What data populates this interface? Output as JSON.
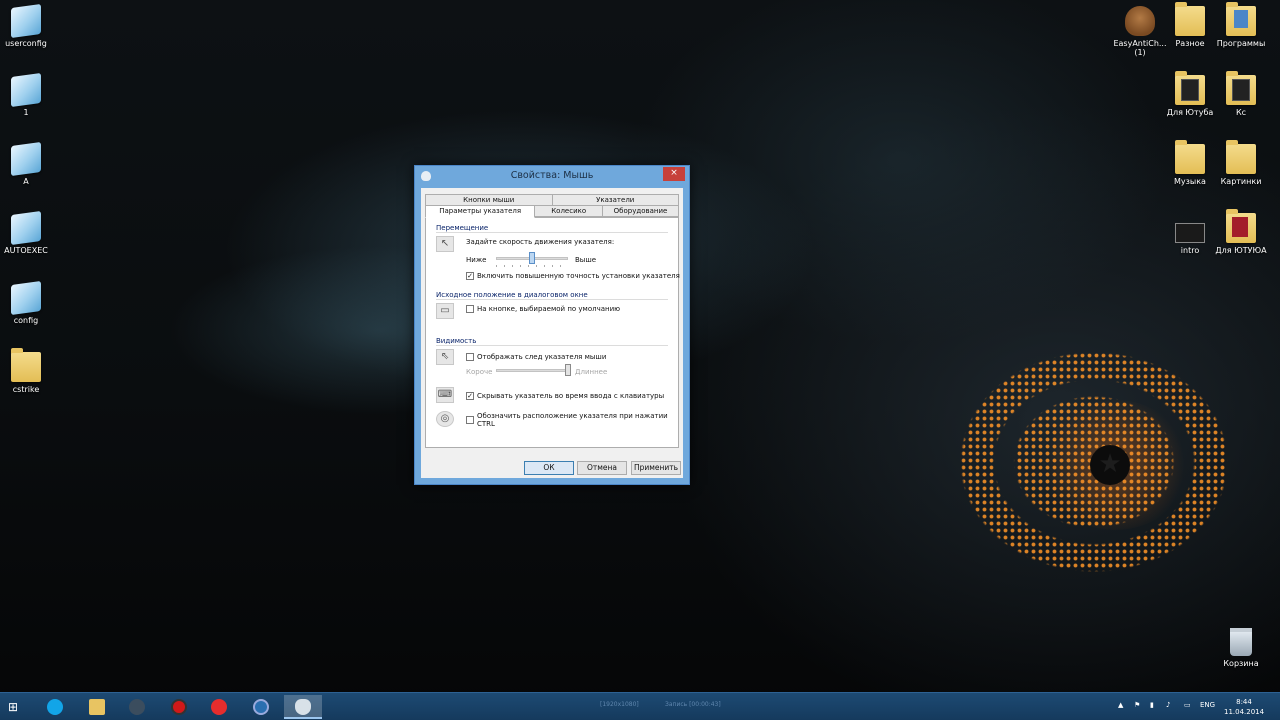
{
  "desktop": {
    "left_icons": [
      {
        "label": "userconfig"
      },
      {
        "label": "1"
      },
      {
        "label": "A"
      },
      {
        "label": "AUTOEXEC"
      },
      {
        "label": "config"
      },
      {
        "label": "cstrike"
      }
    ],
    "right_icons": [
      {
        "label": "EasyAntiCh...\n(1)"
      },
      {
        "label": "Разное"
      },
      {
        "label": "Программы"
      },
      {
        "label": "Для Ютуба"
      },
      {
        "label": "Кс"
      },
      {
        "label": "Музыка"
      },
      {
        "label": "Картинки"
      },
      {
        "label": "intro"
      },
      {
        "label": "Для ЮТУЮА"
      }
    ],
    "recycle_bin": "Корзина"
  },
  "dialog": {
    "title": "Свойства: Мышь",
    "close_glyph": "×",
    "tabs_back": [
      "Кнопки мыши",
      "Указатели"
    ],
    "tabs_front": [
      "Параметры указателя",
      "Колесико",
      "Оборудование"
    ],
    "active_tab": "Параметры указателя",
    "motion": {
      "group": "Перемещение",
      "prompt": "Задайте скорость движения указателя:",
      "slow": "Ниже",
      "fast": "Выше",
      "speed_fraction": 0.5,
      "precision_label": "Включить повышенную точность установки указателя",
      "precision_checked": true
    },
    "snap": {
      "group": "Исходное положение в диалоговом окне",
      "label": "На кнопке, выбираемой по умолчанию",
      "checked": false
    },
    "visibility": {
      "group": "Видимость",
      "trails_label": "Отображать след указателя мыши",
      "trails_checked": false,
      "short": "Короче",
      "long": "Длиннее",
      "trail_fraction": 1.0,
      "hide_label": "Скрывать указатель во время ввода с клавиатуры",
      "hide_checked": true,
      "ctrl_label_line1": "Обозначить расположение указателя при нажатии",
      "ctrl_label_line2": "CTRL",
      "ctrl_checked": false
    },
    "buttons": {
      "ok": "ОК",
      "cancel": "Отмена",
      "apply": "Применить"
    }
  },
  "taskbar": {
    "rec_left": "[1920x1080]",
    "rec_mid": "Запись [00:00:43]",
    "tray_lang": "ENG",
    "time": "8:44",
    "date": "11.04.2014"
  }
}
